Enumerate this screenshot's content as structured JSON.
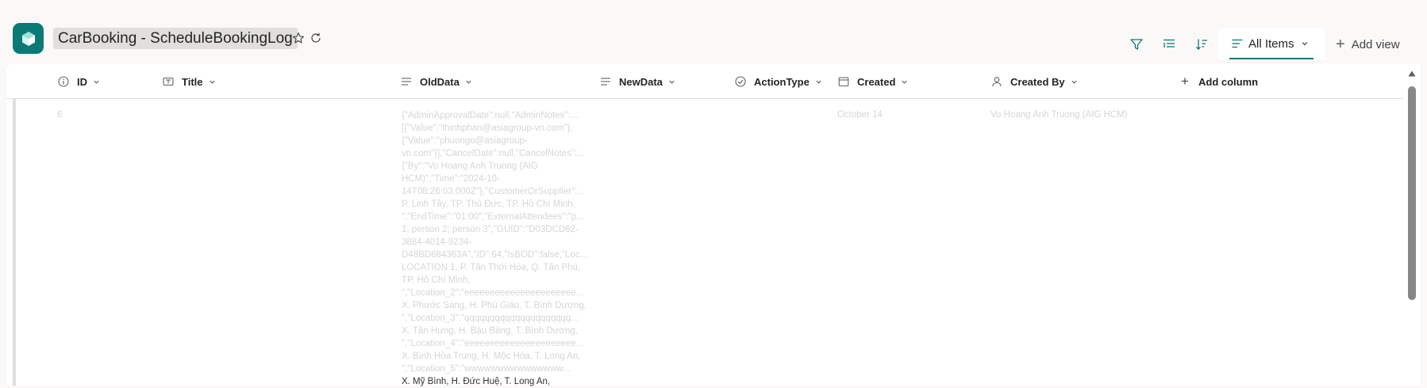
{
  "app": {
    "title": "CarBooking - ScheduleBookingLog",
    "accent_color": "#0b7a75"
  },
  "toolbar": {
    "icons": [
      "filter-icon",
      "group-by-icon",
      "sort-icon"
    ],
    "view_name": "All Items",
    "add_view_label": "Add view"
  },
  "columns": [
    {
      "label": "ID",
      "icon": "info-icon"
    },
    {
      "label": "Title",
      "icon": "text-field-icon"
    },
    {
      "label": "OldData",
      "icon": "lines-icon"
    },
    {
      "label": "NewData",
      "icon": "lines-icon"
    },
    {
      "label": "ActionType",
      "icon": "choice-check-icon"
    },
    {
      "label": "Created",
      "icon": "calendar-icon"
    },
    {
      "label": "Created By",
      "icon": "person-icon"
    }
  ],
  "add_column_label": "Add column",
  "row": {
    "id": "6",
    "title": "",
    "old_data_lines": [
      "{\"AdminApprovalDate\":null,\"AdminNotes\":...",
      "[{\"Value\":\"thinhphan@asiagroup-vn.com\"},",
      "{\"Value\":\"phuongo@asiagroup-",
      "vn.com\"}],\"CancelDate\":null,\"CancelNotes\":...",
      "{\"By\":\"Vo Hoang Anh Truong (AIG",
      "HCM)\",\"Time\":\"2024-10-",
      "14T08:26:03.000Z\"},\"CustomerOrSupplier\":...",
      "P. Linh Tây, TP. Thủ Đức, TP. Hồ Chí Minh,",
      "\",\"EndTime\":\"01:00\",\"ExternalAttendees\":\"p...",
      "1; person 2; person 3\",\"GUID\":\"D03DCD62-",
      "3884-4014-9234-",
      "D48BD684363A\",\"ID\":64,\"IsBOD\":false,\"Loc...",
      "LOCATION 1, P. Tân Thới Hòa, Q. Tân Phú,",
      "TP. Hồ Chí Minh,",
      "\",\"Location_2\":\"eeeeeeeeeeeeeeeeeeeeeeee...",
      "X. Phước Sang, H. Phú Giáo, T. Bình Dương,",
      "\",\"Location_3\":\"qqqqqqqqqqqqqqqqqqqqq...",
      "X. Tân Hưng, H. Bàu Bàng, T. Bình Dương,",
      "\",\"Location_4\":\"eeeeeeeeeeeeeeeeeeeeeeee...",
      "X. Bình Hòa Trung, H. Mộc Hóa, T. Long An,",
      "\",\"Location_5\":\"wwwwwwwwwwwwwww...",
      "X. Mỹ Bình, H. Đức Huệ, T. Long An,"
    ],
    "new_data": "",
    "action_type": "",
    "created": "October 14",
    "created_by": "Vo Hoang Anh Truong (AIG HCM)"
  }
}
